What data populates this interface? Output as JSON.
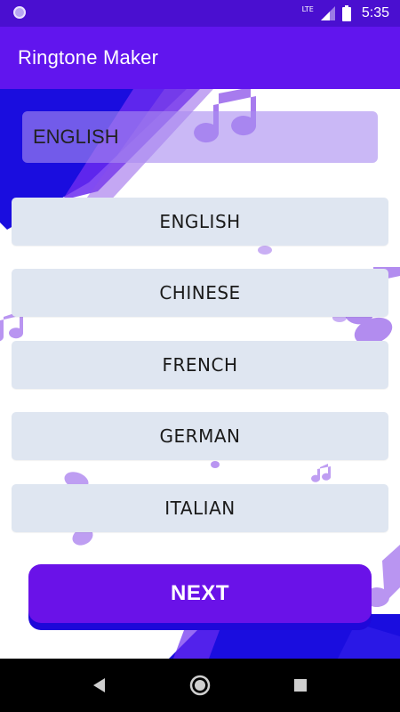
{
  "status_bar": {
    "network": "LTE",
    "time": "5:35"
  },
  "app_bar": {
    "title": "Ringtone Maker"
  },
  "selected_language": {
    "value": "ENGLISH"
  },
  "languages": [
    {
      "label": "ENGLISH"
    },
    {
      "label": "CHINESE"
    },
    {
      "label": "FRENCH"
    },
    {
      "label": "GERMAN"
    },
    {
      "label": "ITALIAN"
    }
  ],
  "next_button": {
    "label": "NEXT"
  },
  "colors": {
    "status_bar": "#4a0fd0",
    "app_bar": "#6115ee",
    "accent": "#6a12e8",
    "accent_dark": "#1e08d9",
    "option_background": "#dfe6f1",
    "note_color": "#8a4fe8"
  },
  "icons": {
    "status_left": "notification-dot-icon",
    "signal": "signal-icon",
    "battery": "battery-icon",
    "nav_back": "back-icon",
    "nav_home": "home-icon",
    "nav_recents": "recents-icon",
    "decorations": "music-note-icon"
  }
}
